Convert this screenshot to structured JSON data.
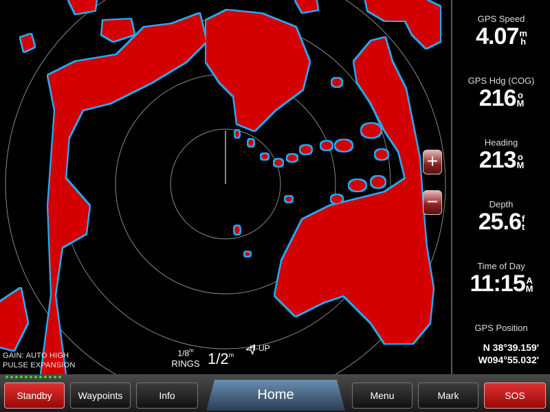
{
  "overlay": {
    "gain": "GAIN: AUTO HIGH",
    "pulse": "PULSE EXPANSION",
    "rings_value": "1/8",
    "rings_unit": "m",
    "rings_label": "RINGS",
    "range_value": "1/2",
    "range_unit": "m",
    "orientation": "H-UP",
    "zoom_in": "+",
    "zoom_out": "−"
  },
  "data_fields": [
    {
      "label": "GPS Speed",
      "value": "4.07",
      "unit_top": "m",
      "unit_bottom": "h"
    },
    {
      "label": "GPS Hdg (COG)",
      "value": "216",
      "unit_top": "o",
      "unit_bottom": "M"
    },
    {
      "label": "Heading",
      "value": "213",
      "unit_top": "o",
      "unit_bottom": "M"
    },
    {
      "label": "Depth",
      "value": "25.6",
      "unit_top": "f",
      "unit_bottom": "t"
    },
    {
      "label": "Time of Day",
      "value": "11:15",
      "unit_top": "A",
      "unit_bottom": "M"
    }
  ],
  "position": {
    "label": "GPS Position",
    "lat": "N  38°39.159'",
    "lon": "W094°55.032'"
  },
  "buttons": {
    "standby": "Standby",
    "waypoints": "Waypoints",
    "info": "Info",
    "home": "Home",
    "menu": "Menu",
    "mark": "Mark",
    "sos": "SOS"
  },
  "colors": {
    "echo": "#d40000",
    "edge": "#00a8ff",
    "accent": "#e02020"
  }
}
